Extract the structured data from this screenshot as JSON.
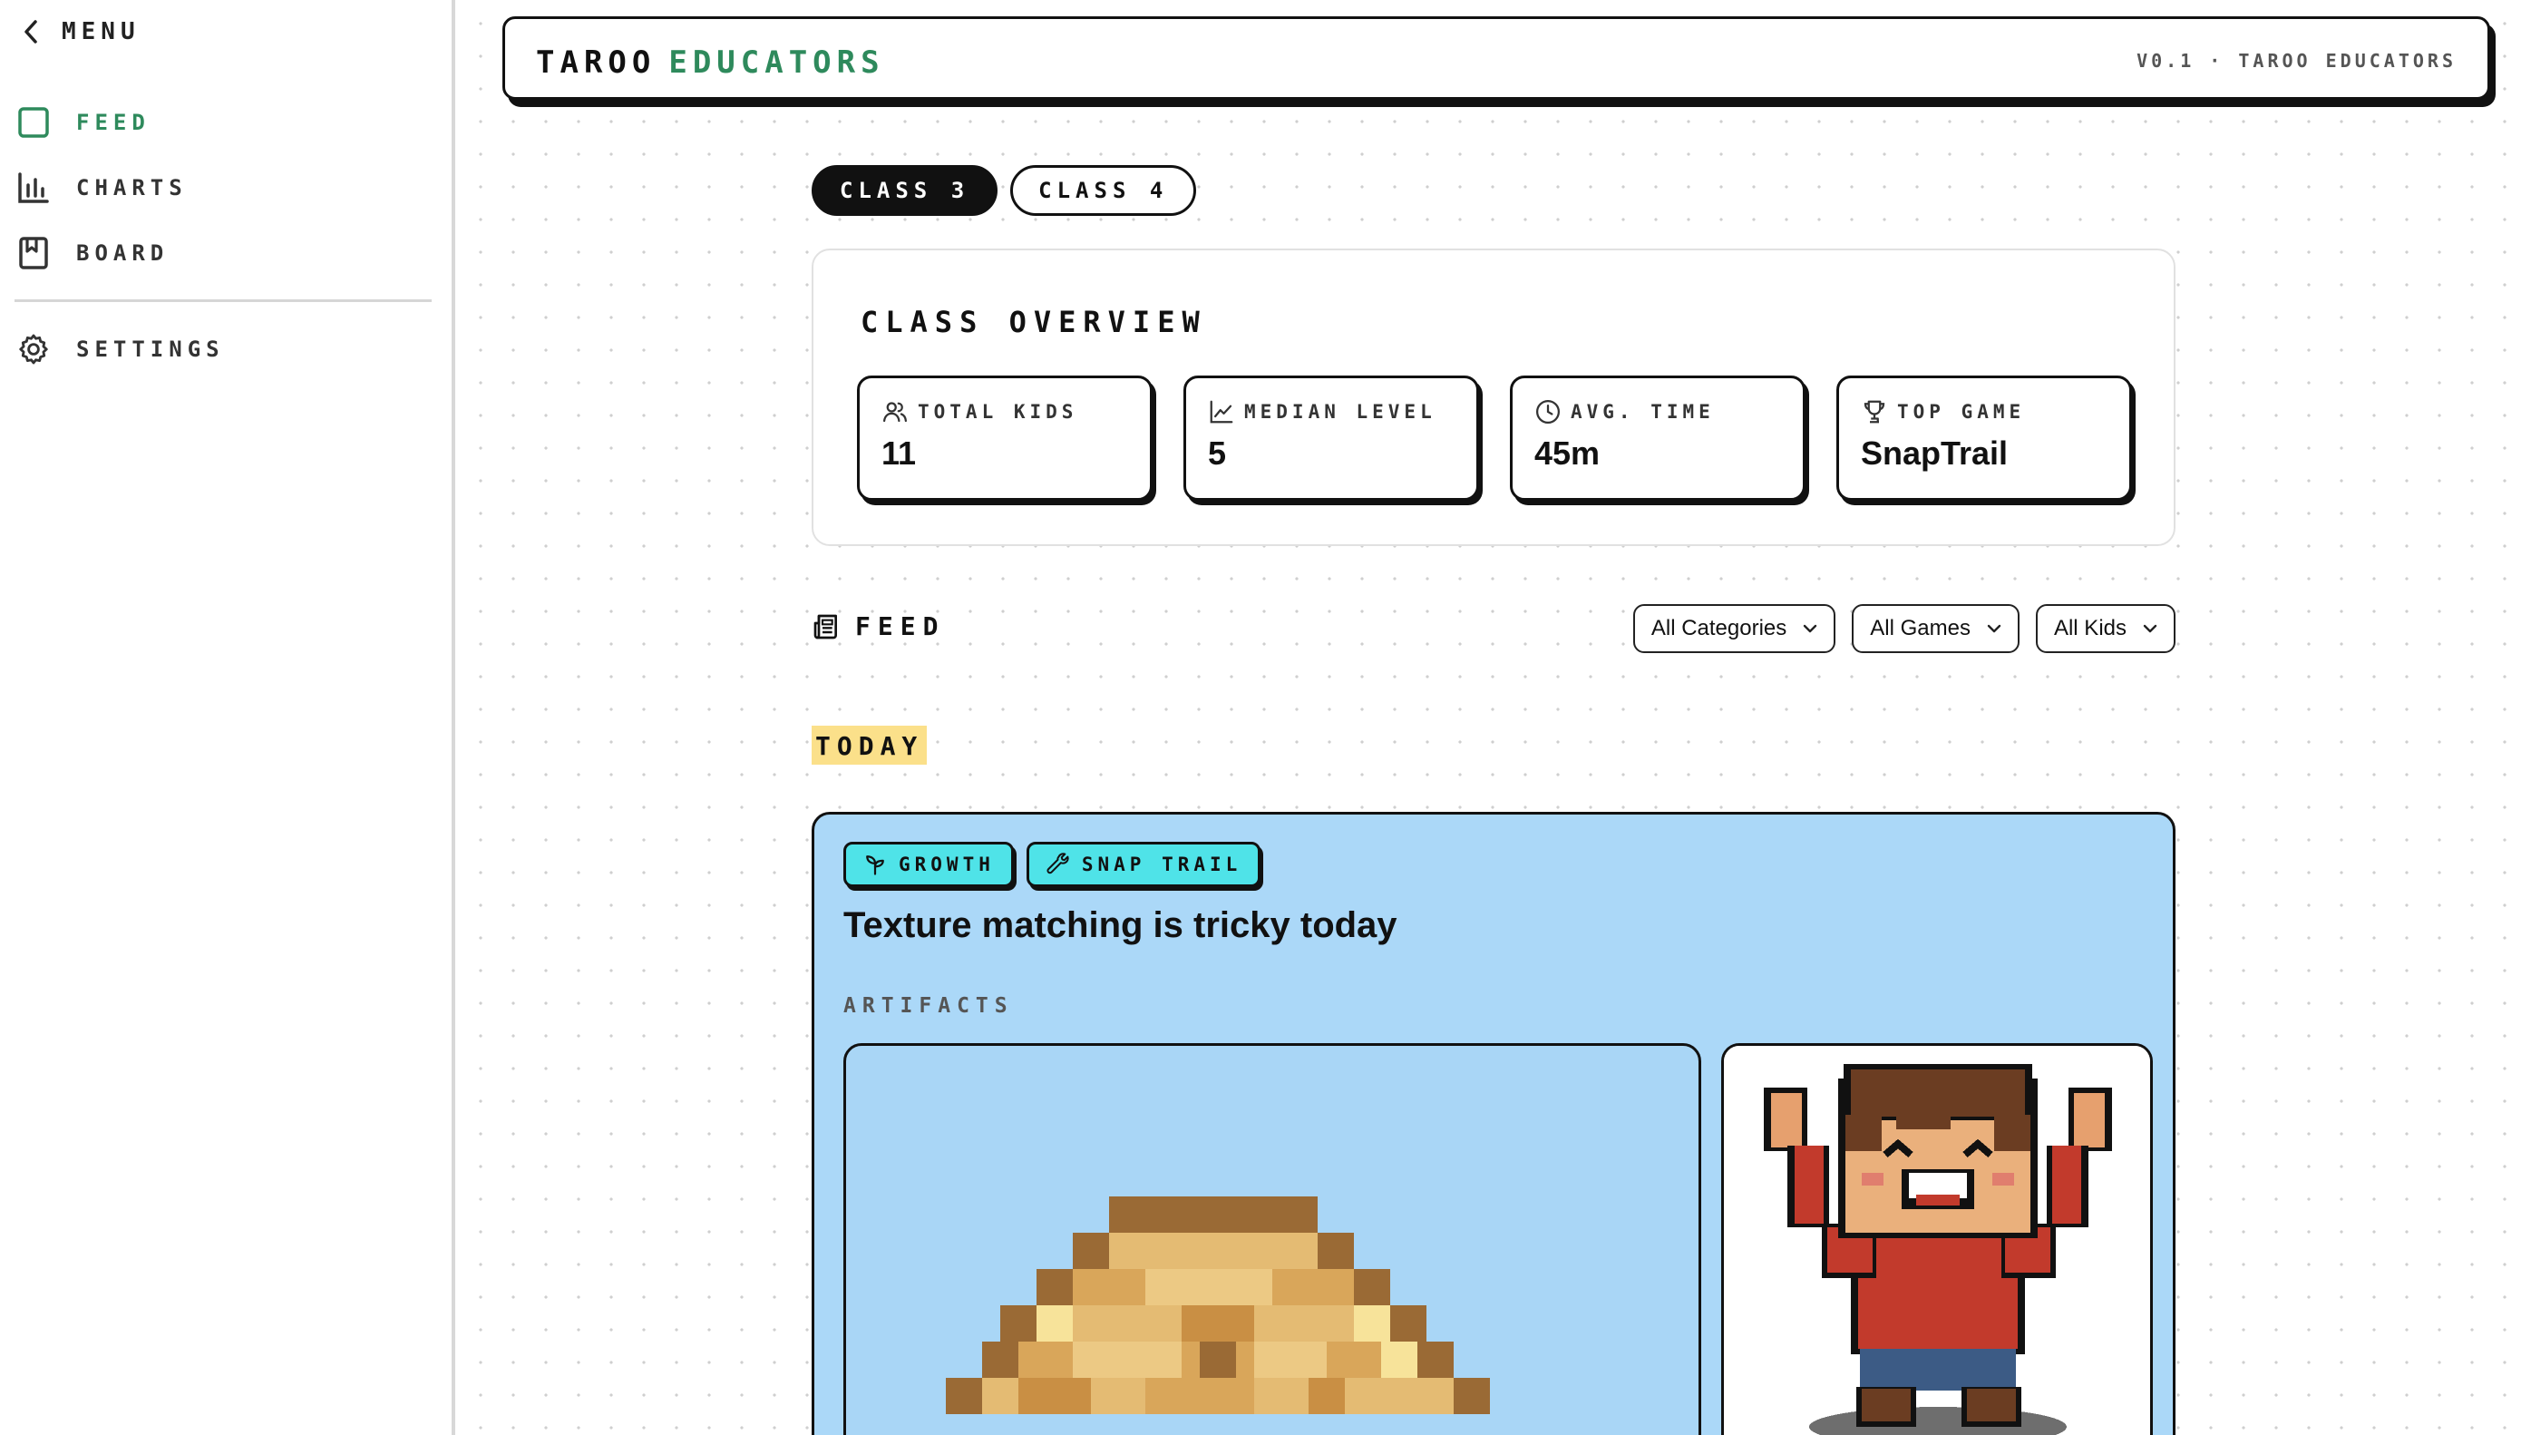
{
  "sidebar": {
    "menu_label": "MENU",
    "items": [
      {
        "label": "FEED",
        "icon": "square-icon"
      },
      {
        "label": "CHARTS",
        "icon": "bar-chart-icon"
      },
      {
        "label": "BOARD",
        "icon": "bookmark-board-icon"
      }
    ],
    "settings_label": "SETTINGS"
  },
  "header": {
    "brand_primary": "TAROO",
    "brand_secondary": "EDUCATORS",
    "version": "V0.1 · TAROO EDUCATORS"
  },
  "class_tabs": [
    {
      "label": "CLASS 3",
      "active": true
    },
    {
      "label": "CLASS 4",
      "active": false
    }
  ],
  "overview": {
    "title": "CLASS OVERVIEW",
    "stats": [
      {
        "label": "TOTAL KIDS",
        "value": "11",
        "icon": "users-icon"
      },
      {
        "label": "MEDIAN LEVEL",
        "value": "5",
        "icon": "line-chart-icon"
      },
      {
        "label": "AVG. TIME",
        "value": "45m",
        "icon": "clock-icon"
      },
      {
        "label": "TOP GAME",
        "value": "SnapTrail",
        "icon": "trophy-icon"
      }
    ]
  },
  "feed": {
    "title": "FEED",
    "filters": [
      "All Categories",
      "All Games",
      "All Kids"
    ],
    "today_label": "TODAY",
    "card": {
      "tags": [
        {
          "label": "GROWTH",
          "icon": "sprout-icon"
        },
        {
          "label": "SNAP TRAIL",
          "icon": "wrench-icon"
        }
      ],
      "title": "Texture matching is tricky today",
      "artifacts_label": "ARTIFACTS"
    }
  },
  "colors": {
    "accent_green": "#2e8a5c",
    "card_blue": "#abd8f8",
    "tag_cyan": "#4fe3e8",
    "today_highlight": "#fbe08a"
  }
}
